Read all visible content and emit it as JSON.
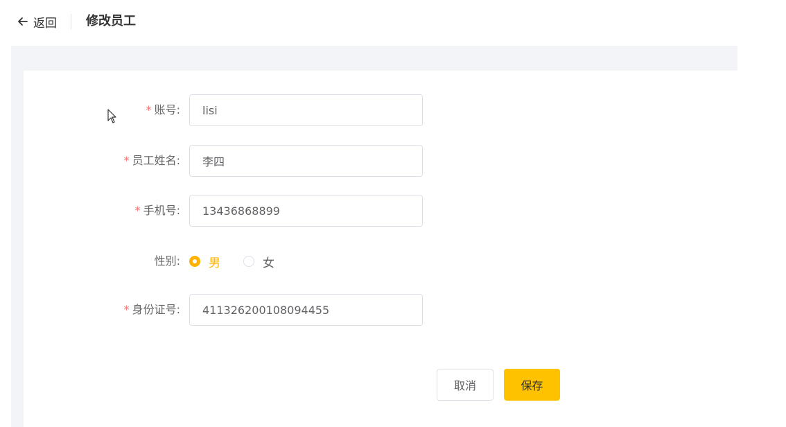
{
  "header": {
    "back_label": "返回",
    "title": "修改员工"
  },
  "form": {
    "account": {
      "label": "账号:",
      "value": "lisi",
      "required": true
    },
    "name": {
      "label": "员工姓名:",
      "value": "李四",
      "required": true
    },
    "phone": {
      "label": "手机号:",
      "value": "13436868899",
      "required": true
    },
    "gender": {
      "label": "性别:",
      "options": [
        "男",
        "女"
      ],
      "selected": "男",
      "required": false
    },
    "id_number": {
      "label": "身份证号:",
      "value": "411326200108094455",
      "required": true
    },
    "required_mark": "*"
  },
  "actions": {
    "cancel_label": "取消",
    "save_label": "保存"
  },
  "colors": {
    "accent": "#ffc200",
    "required": "#f56c6c",
    "background": "#f3f4f7"
  }
}
